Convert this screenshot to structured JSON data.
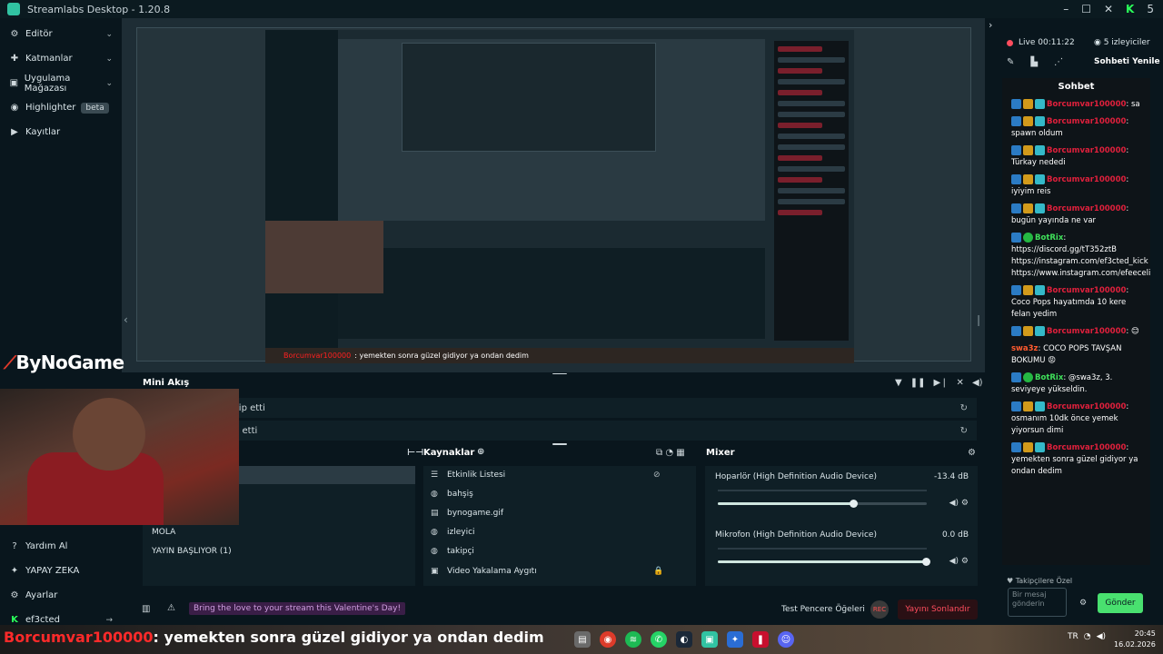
{
  "window": {
    "title": "Streamlabs Desktop - 1.20.8",
    "minimize": "–",
    "maximize": "☐",
    "close": "✕",
    "brand_badge": "5"
  },
  "sidebar": {
    "items": [
      {
        "label": "Editör",
        "icon": "editor-icon",
        "glyph": "⚙",
        "chevron": "⌄"
      },
      {
        "label": "Katmanlar",
        "icon": "layers-icon",
        "glyph": "✚",
        "chevron": "⌄"
      },
      {
        "label": "Uygulama Mağazası",
        "icon": "store-icon",
        "glyph": "▣",
        "chevron": "⌄"
      },
      {
        "label": "Highlighter",
        "icon": "highlighter-icon",
        "glyph": "◉",
        "badge": "beta"
      },
      {
        "label": "Kayıtlar",
        "icon": "recordings-icon",
        "glyph": "▶"
      }
    ],
    "bottom": [
      {
        "label": "Yardım Al",
        "icon": "help-icon",
        "glyph": "?"
      },
      {
        "label": "YAPAY ZEKA",
        "icon": "ai-icon",
        "glyph": "✦"
      },
      {
        "label": "Ayarlar",
        "icon": "settings-icon",
        "glyph": "⚙"
      },
      {
        "label": "ef3cted",
        "icon": "user-icon",
        "glyph": "K",
        "action": "→"
      }
    ]
  },
  "preview": {
    "nested_ticker_user": "Borcumvar100000",
    "nested_ticker_text": ": yemekten sonra güzel gidiyor ya ondan dedim"
  },
  "mini_flow": {
    "title": "Mini Akış",
    "events": [
      {
        "text": "kip etti"
      },
      {
        "text": "p etti"
      }
    ]
  },
  "scenes": {
    "items": [
      "MOLA",
      "YAYIN BAŞLIYOR (1)"
    ]
  },
  "sources": {
    "title": "Kaynaklar",
    "items": [
      {
        "label": "Etkinlik Listesi",
        "icon": "list-icon",
        "glyph": "☰",
        "right": "⊘"
      },
      {
        "label": "bahşiş",
        "icon": "globe-icon",
        "glyph": "◍"
      },
      {
        "label": "bynogame.gif",
        "icon": "file-icon",
        "glyph": "▤"
      },
      {
        "label": "izleyici",
        "icon": "globe-icon",
        "glyph": "◍"
      },
      {
        "label": "takipçi",
        "icon": "globe-icon",
        "glyph": "◍"
      },
      {
        "label": "Video Yakalama Aygıtı",
        "icon": "camera-icon",
        "glyph": "▣",
        "right": "🔒"
      }
    ]
  },
  "mixer": {
    "title": "Mixer",
    "channels": [
      {
        "name": "Hoparlör (High Definition Audio Device)",
        "db": "-13.4 dB",
        "level": 0.65
      },
      {
        "name": "Mikrofon (High Definition Audio Device)",
        "db": "0.0 dB",
        "level": 1.0
      }
    ]
  },
  "footer": {
    "valentine": "Bring the love to your stream this Valentine's Day!",
    "test_elements": "Test Pencere Öğeleri",
    "rec": "REC",
    "end_stream": "Yayını Sonlandır"
  },
  "overlay": {
    "brand": "ByNoGame"
  },
  "chat": {
    "live_label": "Live",
    "live_time": "00:11:22",
    "viewers": "5 izleyiciler",
    "refresh": "Sohbeti Yenile",
    "title": "Sohbet",
    "messages": [
      {
        "user": "Borcumvar100000",
        "color": "red",
        "text": "sa"
      },
      {
        "user": "Borcumvar100000",
        "color": "red",
        "text": "spawn oldum"
      },
      {
        "user": "Borcumvar100000",
        "color": "red",
        "text": "Türkay nededi"
      },
      {
        "user": "Borcumvar100000",
        "color": "red",
        "text": "iyiyim reis"
      },
      {
        "user": "Borcumvar100000",
        "color": "red",
        "text": "bugün yayında ne var"
      },
      {
        "user": "BotRix",
        "color": "green",
        "text": "https://discord.gg/tT352ztB https://instagram.com/ef3cted_kick https://www.instagram.com/efeecelik1/"
      },
      {
        "user": "Borcumvar100000",
        "color": "red",
        "text": "Coco Pops hayatımda 10 kere felan yedim"
      },
      {
        "user": "Borcumvar100000",
        "color": "red",
        "text": "😊"
      },
      {
        "user": "swa3z",
        "color": "orange",
        "text": "COCO POPS TAVŞAN BOKUMU 😡"
      },
      {
        "user": "BotRix",
        "color": "green",
        "text": "@swa3z, 3. seviyeye yükseldin."
      },
      {
        "user": "Borcumvar100000",
        "color": "red",
        "text": "osmanım 10dk önce yemek yiyorsun dimi"
      },
      {
        "user": "Borcumvar100000",
        "color": "red",
        "text": "yemekten sonra güzel gidiyor ya ondan dedim"
      }
    ],
    "follower_label": "Takipçilere Özel",
    "input_placeholder": "Bir mesaj gönderin",
    "send": "Gönder"
  },
  "taskbar": {
    "ticker_user": "Borcumvar100000",
    "ticker_text": ": yemekten sonra güzel gidiyor ya ondan dedim",
    "time": "20:45",
    "date": "16.02.2026",
    "tray_lang": "TR"
  }
}
